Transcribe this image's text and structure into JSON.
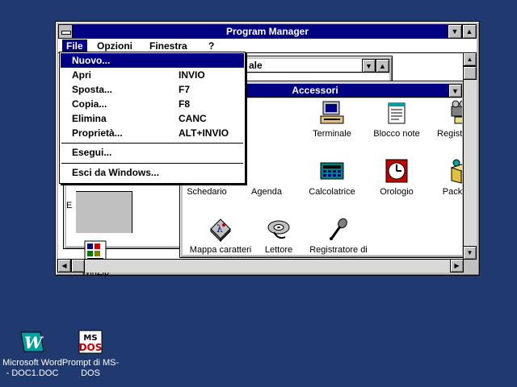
{
  "window": {
    "title": "Program Manager",
    "minimize_glyph": "▼",
    "maximize_glyph": "▲"
  },
  "menubar": {
    "items": [
      "File",
      "Opzioni",
      "Finestra",
      "?"
    ]
  },
  "file_menu": {
    "items": [
      {
        "label": "Nuovo...",
        "shortcut": ""
      },
      {
        "label": "Apri",
        "shortcut": "INVIO"
      },
      {
        "label": "Sposta...",
        "shortcut": "F7"
      },
      {
        "label": "Copia...",
        "shortcut": "F8"
      },
      {
        "label": "Elimina",
        "shortcut": "CANC"
      },
      {
        "label": "Proprietà...",
        "shortcut": "ALT+INVIO"
      },
      {
        "label": "Esegui...",
        "shortcut": ""
      },
      {
        "label": "Esci da Windows...",
        "shortcut": ""
      }
    ]
  },
  "back_group": {
    "title_fragment": "ale",
    "partial_label": "E",
    "winzip_label": "WinZip"
  },
  "accessori": {
    "title": "Accessori",
    "items": [
      "Terminale",
      "Blocco note",
      "Registratore",
      "Schedario",
      "Agenda",
      "Calcolatrice",
      "Orologio",
      "Packager",
      "Mappa caratteri",
      "Lettore multimediale",
      "Registratore di suoni"
    ]
  },
  "desktop": {
    "icons": [
      {
        "label": "Microsoft Word - DOC1.DOC"
      },
      {
        "label": "Prompt di MS-DOS"
      }
    ],
    "msdos_text": "MS-DOS"
  },
  "colors": {
    "desktop": "#203a70",
    "titlebar": "#000080",
    "chrome": "#c0c0c0"
  }
}
